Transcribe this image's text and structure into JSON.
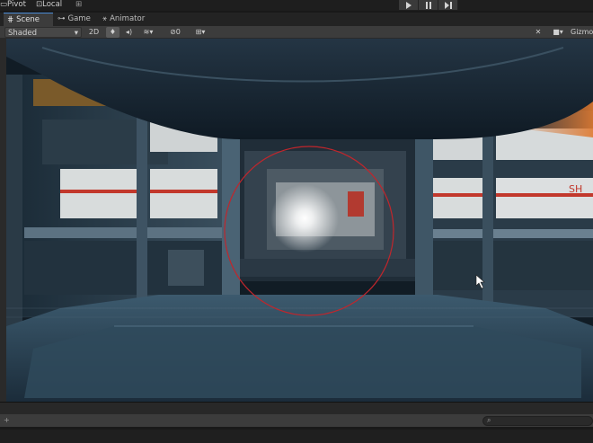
{
  "toolbar": {
    "pivot_label": "Pivot",
    "local_label": "Local"
  },
  "tabs": [
    {
      "label": "Scene",
      "icon": "grid-icon",
      "active": true
    },
    {
      "label": "Game",
      "icon": "gamepad-icon",
      "active": false
    },
    {
      "label": "Animator",
      "icon": "animator-icon",
      "active": false
    }
  ],
  "scene_toolbar": {
    "shading_mode": "Shaded",
    "mode_2d": "2D",
    "hidden_count": "0",
    "gizmos_label": "Gizmos"
  },
  "scene": {
    "wall_sign": "SH",
    "selection_ring_color": "#c0262c",
    "light_color": "#ffffff",
    "accent_stripe_color": "#c2382c"
  }
}
